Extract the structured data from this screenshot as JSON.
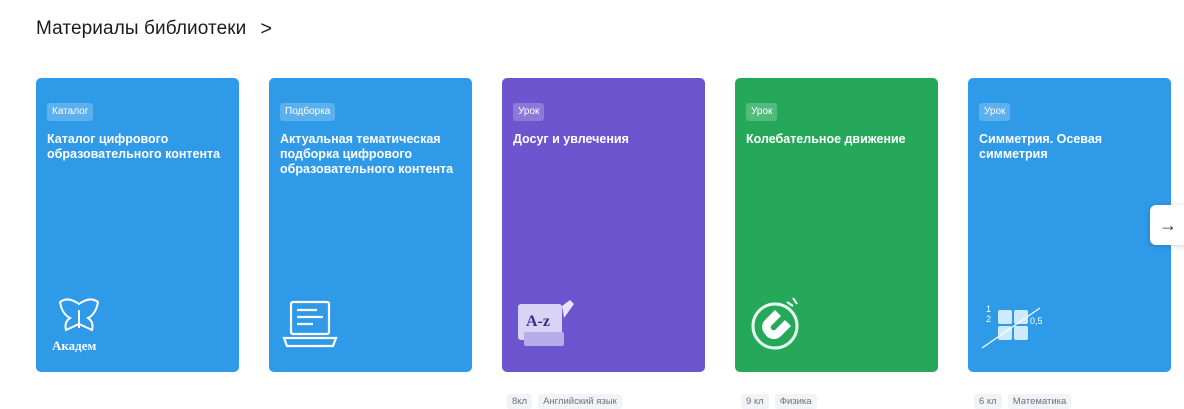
{
  "section": {
    "title": "Материалы библиотеки",
    "chevron": ">"
  },
  "cards": [
    {
      "tag": "Каталог",
      "title": "Каталог цифрового образовательного контента",
      "color": "#2f9ae8",
      "icon": "academy-crest-icon"
    },
    {
      "tag": "Подборка",
      "title": "Актуальная тематическая подборка цифрового образовательного контента",
      "color": "#2f9ae8",
      "icon": "laptop-icon"
    },
    {
      "tag": "Урок",
      "title": "Досуг и увлечения",
      "color": "#6c55cf",
      "icon": "dictionary-scroll-icon",
      "meta": [
        "8кл",
        "Английский язык"
      ]
    },
    {
      "tag": "Урок",
      "title": "Колебательное движение",
      "color": "#25a85a",
      "icon": "magnet-icon",
      "meta": [
        "9 кл",
        "Физика"
      ]
    },
    {
      "tag": "Урок",
      "title": "Симметрия. Осевая симметрия",
      "color": "#2f9ae8",
      "icon": "math-grid-icon",
      "meta": [
        "6 кл",
        "Математика"
      ]
    }
  ],
  "carousel": {
    "next_icon": "→"
  }
}
